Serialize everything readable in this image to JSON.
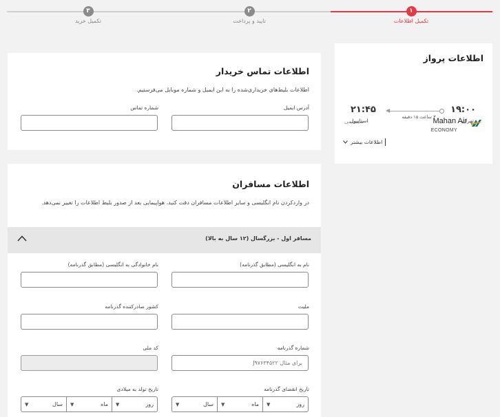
{
  "stepper": {
    "steps": [
      {
        "number": "۱",
        "label": "تکمیل اطلاعات",
        "state": "active"
      },
      {
        "number": "۲",
        "label": "تایید و پرداخت",
        "state": "pending"
      },
      {
        "number": "۳",
        "label": "تکمیل خرید",
        "state": "pending"
      }
    ]
  },
  "flight": {
    "title": "اطلاعات پرواز",
    "airline": "Mahan Air",
    "cabin_class": "ECONOMY",
    "system_label": "سیستمی",
    "departure_time": "۱۹:۰۰",
    "departure_city": "تهران",
    "arrival_time": "۲۱:۴۵",
    "arrival_city": "استانبول",
    "duration": "۳ ساعت ۱۵ دقیقه",
    "more_info_label": "اطلاعات بیشتر",
    "logo_icon": "mahan-air-logo-icon"
  },
  "contact": {
    "title": "اطلاعات تماس خریدار",
    "description": "اطلاعات بلیط‌های خریداری‌شده را به این ایمیل و شماره موبایل می‌فرستیم.",
    "email_label": "آدرس ایمیل",
    "email_value": "",
    "phone_label": "شماره تماس",
    "phone_value": ""
  },
  "passengers": {
    "title": "اطلاعات مسافران",
    "description": "در واردکردن نام انگلیسی و سایر اطلاعات مسافران دقت کنید، هواپیمایی بعد از صدور بلیط اطلاعات را تغییر نمی‌دهد.",
    "passenger_header": "مسافر اول - بزرگسال (۱۲ سال به بالا)",
    "first_name_label": "نام به انگلیسی (مطابق گذرنامه)",
    "last_name_label": "نام خانوادگی به انگلیسی (مطابق گذرنامه)",
    "nationality_label": "ملیت",
    "issuing_country_label": "کشور صادرکننده گذرنامه",
    "passport_number_label": "شماره گذرنامه",
    "passport_number_placeholder": "برای مثال J۹۷۶۳۴۵۲۲",
    "national_code_label": "کد ملی",
    "passport_expiry_label": "تاریخ انقضای گذرنامه",
    "birth_date_label": "تاریخ تولد به میلادی",
    "day_label": "روز",
    "month_label": "ماه",
    "year_label": "سال"
  },
  "colors": {
    "accent": "#e63946",
    "pending": "#8b8b8b",
    "card_bg": "#ffffff",
    "page_bg": "#f2f2f2"
  }
}
